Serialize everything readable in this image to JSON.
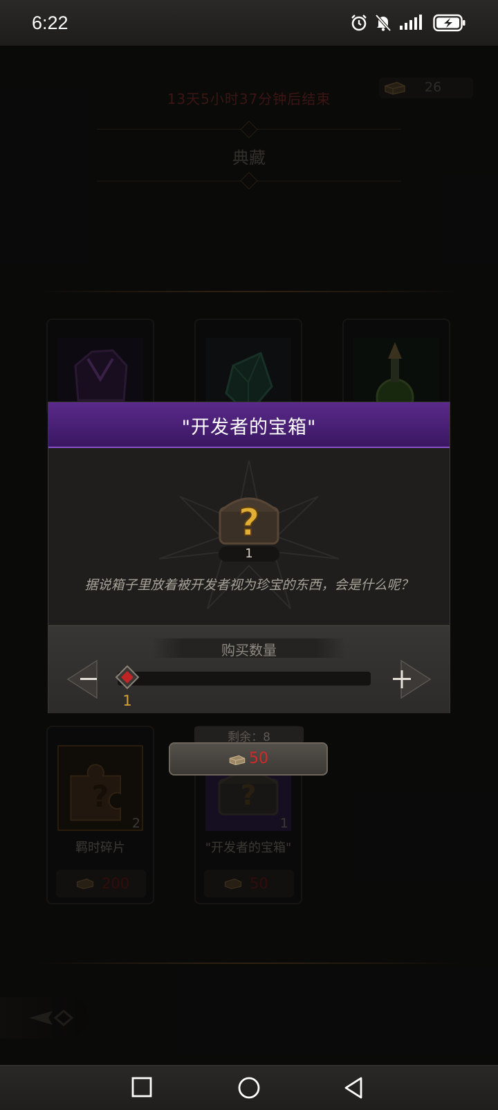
{
  "status_bar": {
    "time": "6:22",
    "icons": [
      "alarm-icon",
      "mute-bell-icon",
      "signal-icon",
      "battery-charging-icon"
    ]
  },
  "shop": {
    "countdown": "13天5小时37分钟后结束",
    "currency_amount": "26",
    "section_title": "典藏",
    "items": [
      {
        "name": "羁时碎片",
        "quantity": "2",
        "price": "200"
      },
      {
        "name": "\"开发者的宝箱\"",
        "quantity": "1",
        "price": "50",
        "remaining": "剩余：8"
      }
    ]
  },
  "dialog": {
    "title": "\"开发者的宝箱\"",
    "item_count": "1",
    "description": "据说箱子里放着被开发者视为珍宝的东西，会是什么呢？",
    "quantity_label": "购买数量",
    "slider": {
      "value": "1",
      "min": 1,
      "max": 8
    },
    "buy_price": "50"
  },
  "colors": {
    "header_purple": "#4a1f76",
    "price_red": "#d02a2a",
    "slider_value_gold": "#d6a536"
  },
  "nav_bar": [
    "recent-apps-icon",
    "home-icon",
    "back-icon"
  ]
}
